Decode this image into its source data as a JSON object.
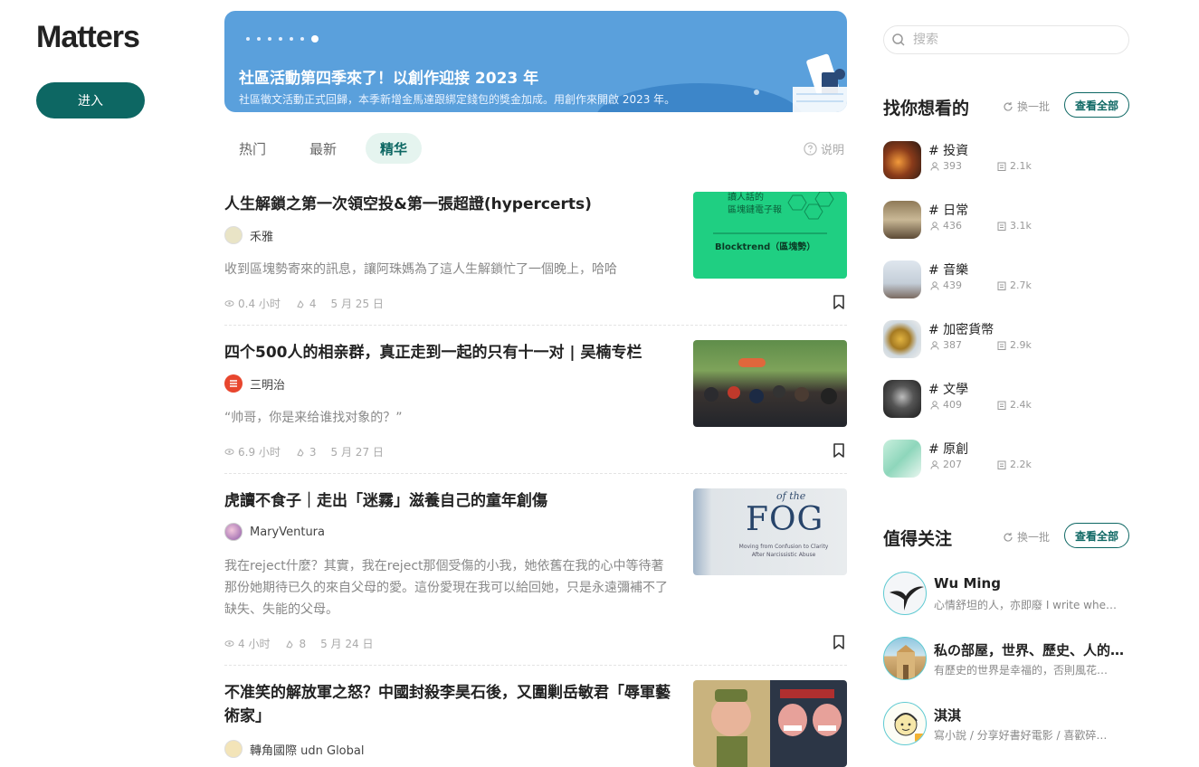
{
  "app": {
    "logo": "Matters",
    "enter_label": "进入"
  },
  "banner": {
    "title": "社區活動第四季來了！以創作迎接 2023 年",
    "subtitle": "社區徵文活動正式回歸，本季新增金馬達跟綁定錢包的獎金加成。用創作來開啟 2023 年。",
    "dots_count": 7,
    "active_dot": 6
  },
  "feed_tabs": [
    {
      "label": "热门",
      "active": false
    },
    {
      "label": "最新",
      "active": false
    },
    {
      "label": "精华",
      "active": true
    }
  ],
  "help_label": "说明",
  "articles": [
    {
      "title": "人生解鎖之第一次領空投&第一張超證(hypercerts)",
      "author": "禾雅",
      "summary": "收到區塊勢寄來的訊息，讓阿珠媽為了這人生解鎖忙了一個晚上，哈哈",
      "read_time": "0.4 小时",
      "claps": "4",
      "date": "5 月 25 日",
      "thumb_text_top": "讀人話的\n區塊鏈電子報",
      "thumb_text_main": "Blocktrend（區塊勢）"
    },
    {
      "title": "四个500人的相亲群，真正走到一起的只有十一对 | 吴楠专栏",
      "author": "三明治",
      "summary": "“帅哥，你是来给谁找对象的？”",
      "read_time": "6.9 小时",
      "claps": "3",
      "date": "5 月 27 日"
    },
    {
      "title": "虎讀不食子｜走出「迷霧」滋養自己的童年創傷",
      "author": "MaryVentura",
      "summary": "我在reject什麼？其實，我在reject那個受傷的小我，她依舊在我的心中等待著那份她期待已久的來自父母的愛。這份愛現在我可以給回她，只是永遠彌補不了缺失、失能的父母。",
      "read_time": "4 小时",
      "claps": "8",
      "date": "5 月 24 日",
      "thumb_text_top": "of the",
      "thumb_text_main": "FOG",
      "thumb_text_sub": "Moving from Confusion to Clarity After Narcissistic Abuse"
    },
    {
      "title": "不准笑的解放軍之怒？中國封殺李昊石後，又圍剿岳敏君「辱軍藝術家」",
      "author": "轉角國際 udn Global"
    }
  ],
  "search": {
    "placeholder": "搜索"
  },
  "tags_section": {
    "title": "找你想看的",
    "shuffle_label": "换一批",
    "view_all_label": "查看全部",
    "items": [
      {
        "name": "# 投資",
        "followers": "393",
        "articles": "2.1k",
        "color": "#7a4a2a"
      },
      {
        "name": "# 日常",
        "followers": "436",
        "articles": "3.1k",
        "color": "#b7a58b"
      },
      {
        "name": "# 音樂",
        "followers": "439",
        "articles": "2.7k",
        "color": "#c9d3dc"
      },
      {
        "name": "# 加密貨幣",
        "followers": "387",
        "articles": "2.9k",
        "color": "#c4a04a"
      },
      {
        "name": "# 文學",
        "followers": "409",
        "articles": "2.4k",
        "color": "#3a3a3a"
      },
      {
        "name": "# 原創",
        "followers": "207",
        "articles": "2.2k",
        "color": "#9fd9c4"
      }
    ]
  },
  "follow_section": {
    "title": "值得关注",
    "shuffle_label": "换一批",
    "view_all_label": "查看全部",
    "users": [
      {
        "name": "Wu Ming",
        "desc": "心情舒坦的人，亦即廢 I write whe…"
      },
      {
        "name": "私の部屋，世界、歷史、人的…",
        "desc": "有歷史的世界是幸福的，否則風花…"
      },
      {
        "name": "淇淇",
        "desc": "寫小說 / 分享好書好電影 / 喜歡碎…"
      }
    ]
  }
}
